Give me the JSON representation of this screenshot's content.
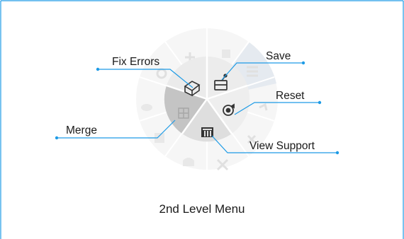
{
  "figure": {
    "caption": "2nd Level Menu",
    "accent_color": "#1e9be6"
  },
  "menu": {
    "inner_items": [
      {
        "label": "Fix Errors",
        "icon": "fix-errors-icon"
      },
      {
        "label": "Save",
        "icon": "save-icon"
      },
      {
        "label": "Reset",
        "icon": "reset-icon"
      },
      {
        "label": "View Support",
        "icon": "view-support-icon"
      },
      {
        "label": "Merge",
        "icon": "merge-icon"
      }
    ],
    "outer_faded_icons": [
      "plus-icon",
      "resize-icon",
      "list-icon",
      "arrow-icon",
      "arrow-icon",
      "close-icon",
      "paint-icon",
      "cube-icon",
      "eye-icon",
      "scissors-icon"
    ]
  }
}
